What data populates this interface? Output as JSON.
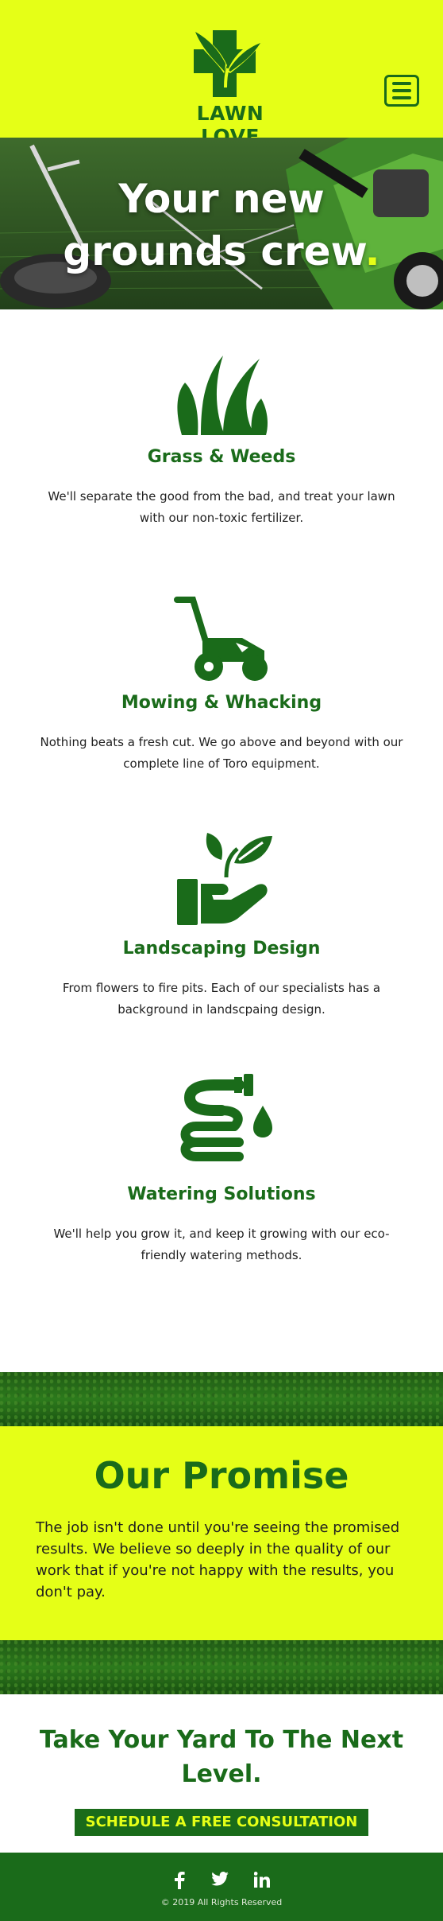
{
  "brand": {
    "name": "LAWN LOVE",
    "primary_color": "#1a6b1a",
    "accent_color": "#e5ff17"
  },
  "header": {
    "menu_icon": "hamburger-icon"
  },
  "hero": {
    "title_line1": "Your new",
    "title_line2": "grounds crew",
    "title_dot": "."
  },
  "services": [
    {
      "icon": "grass-icon",
      "title": "Grass & Weeds",
      "description": "We'll separate the good from the bad, and treat your lawn with our non-toxic fertilizer."
    },
    {
      "icon": "lawn-mower-icon",
      "title": "Mowing & Whacking",
      "description": "Nothing beats a fresh cut. We go above and beyond with our complete line of Toro equipment."
    },
    {
      "icon": "plant-in-hand-icon",
      "title": "Landscaping Design",
      "description": "From flowers to fire pits. Each of our specialists has a background in landscpaing design."
    },
    {
      "icon": "water-hose-icon",
      "title": "Watering Solutions",
      "description": "We'll help you grow it, and keep it growing with our eco-friendly watering methods."
    }
  ],
  "promise": {
    "title": "Our Promise",
    "text": "The job isn't done until you're seeing the promised results. We believe so deeply in the quality of our work that if you're not happy with the results, you don't pay."
  },
  "cta": {
    "title": "Take Your Yard To The Next Level.",
    "button_label": "SCHEDULE A FREE CONSULTATION"
  },
  "footer": {
    "social": [
      "facebook-icon",
      "twitter-icon",
      "linkedin-icon"
    ],
    "copyright": "© 2019 All Rights Reserved"
  }
}
